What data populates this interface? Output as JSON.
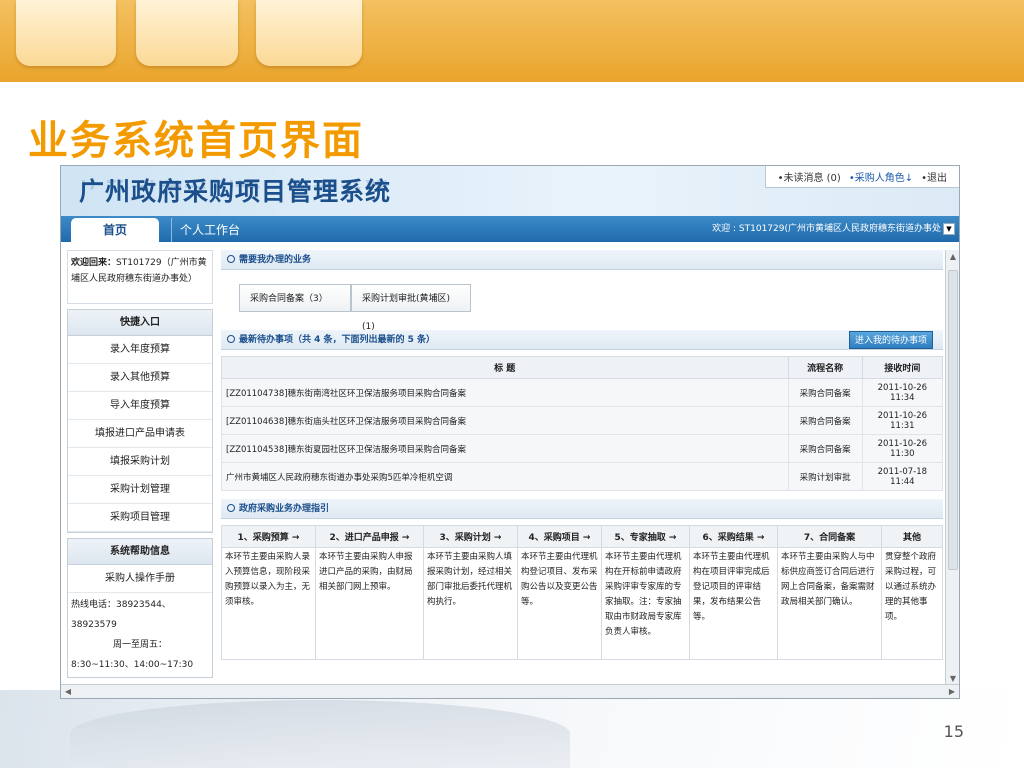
{
  "slide": {
    "title": "业务系统首页界面",
    "page_number": "15"
  },
  "app": {
    "title": "广州政府采购项目管理系统",
    "top_links": [
      "•未读消息 (0)",
      "•采购人角色↓",
      "•退出"
    ],
    "nav": {
      "home": "首页",
      "workbench": "个人工作台",
      "welcome": "欢迎 : ST101729(广州市黄埔区人民政府穗东街道办事处"
    },
    "sidebar": {
      "welcome_label": "欢迎回来：",
      "welcome_user": "ST101729（广州市黄埔区人民政府穗东街道办事处）",
      "shortcut_title": "快捷入口",
      "shortcuts": [
        "录入年度预算",
        "录入其他预算",
        "导入年度预算",
        "填报进口产品申请表",
        "填报采购计划",
        "采购计划管理",
        "采购项目管理"
      ],
      "help_title": "系统帮助信息",
      "manual": "采购人操作手册",
      "hotline": "热线电话：38923544、38923579",
      "days": "周一至周五：",
      "hours": "8:30~11:30、14:00~17:30"
    },
    "pending": {
      "title": "需要我办理的业务",
      "items": [
        "采购合同备案（3）",
        "采购计划审批(黄埔区)(1)"
      ]
    },
    "todo": {
      "title": "最新待办事项（共 4 条，下面列出最新的 5 条）",
      "button": "进入我的待办事项",
      "headers": [
        "标 题",
        "流程名称",
        "接收时间"
      ],
      "rows": [
        {
          "title": "[ZZ01104738]穗东街南湾社区环卫保洁服务项目采购合同备案",
          "flow": "采购合同备案",
          "time": "2011-10-26 11:34"
        },
        {
          "title": "[ZZ01104638]穗东街庙头社区环卫保洁服务项目采购合同备案",
          "flow": "采购合同备案",
          "time": "2011-10-26 11:31"
        },
        {
          "title": "[ZZ01104538]穗东街夏园社区环卫保洁服务项目采购合同备案",
          "flow": "采购合同备案",
          "time": "2011-10-26 11:30"
        },
        {
          "title": "广州市黄埔区人民政府穗东街道办事处采购5匹单冷柜机空调",
          "flow": "采购计划审批",
          "time": "2011-07-18 11:44"
        }
      ]
    },
    "guide": {
      "title": "政府采购业务办理指引",
      "headers": [
        "1、采购预算 →",
        "2、进口产品申报 →",
        "3、采购计划 →",
        "4、采购项目 →",
        "5、专家抽取 →",
        "6、采购结果 →",
        "7、合同备案",
        "其他"
      ],
      "texts": [
        "本环节主要由采购人录入预算信息，现阶段采购预算以录入为主，无须审核。",
        "本环节主要由采购人申报进口产品的采购，由财局相关部门网上预审。",
        "本环节主要由采购人填报采购计划，经过相关部门审批后委托代理机构执行。",
        "本环节主要由代理机构登记项目、发布采购公告以及变更公告等。",
        "本环节主要由代理机构在开标前申请政府采购评审专家库的专家抽取。注：专家抽取由市财政局专家库负责人审核。",
        "本环节主要由代理机构在项目评审完成后登记项目的评审结果，发布结果公告等。",
        "本环节主要由采购人与中标供应商签订合同后进行网上合同备案，备案需财政局相关部门确认。",
        "贯穿整个政府采购过程，可以通过系统办理的其他事项。"
      ]
    }
  }
}
